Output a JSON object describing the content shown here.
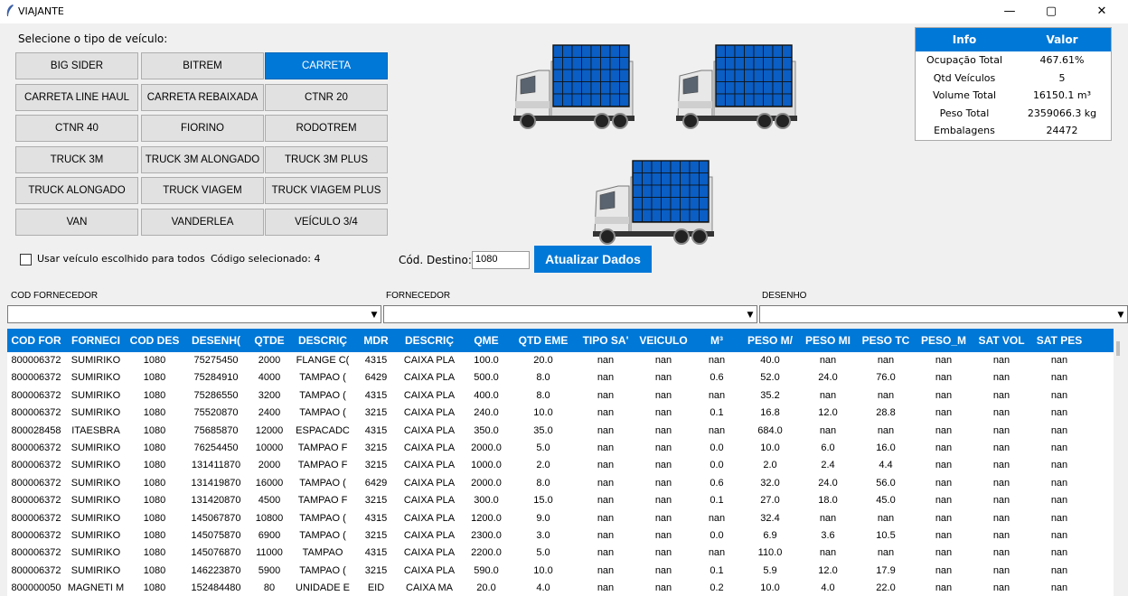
{
  "window": {
    "title": "VIAJANTE",
    "minimize": "—",
    "maximize": "▢",
    "close": "✕"
  },
  "vehicle_type_label": "Selecione o tipo de veículo:",
  "vehicle_buttons": [
    "BIG SIDER",
    "BITREM",
    "CARRETA",
    "CARRETA LINE HAUL",
    "CARRETA REBAIXADA",
    "CTNR 20",
    "CTNR 40",
    "FIORINO",
    "RODOTREM",
    "TRUCK 3M",
    "TRUCK 3M ALONGADO",
    "TRUCK 3M PLUS",
    "TRUCK ALONGADO",
    "TRUCK VIAGEM",
    "TRUCK VIAGEM PLUS",
    "VAN",
    "VANDERLEA",
    "VEÍCULO 3/4"
  ],
  "selected_vehicle": "CARRETA",
  "use_for_all_label": "Usar veículo escolhido para todos",
  "selected_code": "Código selecionado: 4",
  "destination_label": "Cód. Destino:",
  "destination_value": "1080",
  "update_button": "Atualizar Dados",
  "colors": {
    "accent": "#0078d7",
    "cargo": "#0a5ec4",
    "cab": "#e8e8e8"
  },
  "info": {
    "headers": [
      "Info",
      "Valor"
    ],
    "rows": [
      [
        "Ocupação Total",
        "467.61%"
      ],
      [
        "Qtd Veículos",
        "5"
      ],
      [
        "Volume Total",
        "16150.1 m³"
      ],
      [
        "Peso Total",
        "2359066.3 kg"
      ],
      [
        "Embalagens",
        "24472"
      ]
    ]
  },
  "filters": [
    "COD FORNECEDOR",
    "FORNECEDOR",
    "DESENHO"
  ],
  "table": {
    "headers": [
      "COD FOR",
      "FORNECI",
      "COD DES",
      "DESENH(",
      "QTDE",
      "DESCRIÇ",
      "MDR",
      "DESCRIÇ",
      "QME",
      "QTD EME",
      "TIPO SA'",
      "VEICULO",
      "M³",
      "PESO M/",
      "PESO MI",
      "PESO TC",
      "PESO_M",
      "SAT VOL",
      "SAT PES"
    ],
    "rows": [
      [
        "800006372",
        "SUMIRIKO",
        "1080",
        "75275450",
        "2000",
        "FLANGE C(",
        "4315",
        "CAIXA PLA",
        "100.0",
        "20.0",
        "nan",
        "nan",
        "nan",
        "40.0",
        "nan",
        "nan",
        "nan",
        "nan",
        "nan"
      ],
      [
        "800006372",
        "SUMIRIKO",
        "1080",
        "75284910",
        "4000",
        "TAMPAO (",
        "6429",
        "CAIXA PLA",
        "500.0",
        "8.0",
        "nan",
        "nan",
        "0.6",
        "52.0",
        "24.0",
        "76.0",
        "nan",
        "nan",
        "nan"
      ],
      [
        "800006372",
        "SUMIRIKO",
        "1080",
        "75286550",
        "3200",
        "TAMPAO (",
        "4315",
        "CAIXA PLA",
        "400.0",
        "8.0",
        "nan",
        "nan",
        "nan",
        "35.2",
        "nan",
        "nan",
        "nan",
        "nan",
        "nan"
      ],
      [
        "800006372",
        "SUMIRIKO",
        "1080",
        "75520870",
        "2400",
        "TAMPAO (",
        "3215",
        "CAIXA PLA",
        "240.0",
        "10.0",
        "nan",
        "nan",
        "0.1",
        "16.8",
        "12.0",
        "28.8",
        "nan",
        "nan",
        "nan"
      ],
      [
        "800028458",
        "ITAESBRA",
        "1080",
        "75685870",
        "12000",
        "ESPACADC",
        "4315",
        "CAIXA PLA",
        "350.0",
        "35.0",
        "nan",
        "nan",
        "nan",
        "684.0",
        "nan",
        "nan",
        "nan",
        "nan",
        "nan"
      ],
      [
        "800006372",
        "SUMIRIKO",
        "1080",
        "76254450",
        "10000",
        "TAMPAO F",
        "3215",
        "CAIXA PLA",
        "2000.0",
        "5.0",
        "nan",
        "nan",
        "0.0",
        "10.0",
        "6.0",
        "16.0",
        "nan",
        "nan",
        "nan"
      ],
      [
        "800006372",
        "SUMIRIKO",
        "1080",
        "131411870",
        "2000",
        "TAMPAO F",
        "3215",
        "CAIXA PLA",
        "1000.0",
        "2.0",
        "nan",
        "nan",
        "0.0",
        "2.0",
        "2.4",
        "4.4",
        "nan",
        "nan",
        "nan"
      ],
      [
        "800006372",
        "SUMIRIKO",
        "1080",
        "131419870",
        "16000",
        "TAMPAO (",
        "6429",
        "CAIXA PLA",
        "2000.0",
        "8.0",
        "nan",
        "nan",
        "0.6",
        "32.0",
        "24.0",
        "56.0",
        "nan",
        "nan",
        "nan"
      ],
      [
        "800006372",
        "SUMIRIKO",
        "1080",
        "131420870",
        "4500",
        "TAMPAO F",
        "3215",
        "CAIXA PLA",
        "300.0",
        "15.0",
        "nan",
        "nan",
        "0.1",
        "27.0",
        "18.0",
        "45.0",
        "nan",
        "nan",
        "nan"
      ],
      [
        "800006372",
        "SUMIRIKO",
        "1080",
        "145067870",
        "10800",
        "TAMPAO (",
        "4315",
        "CAIXA PLA",
        "1200.0",
        "9.0",
        "nan",
        "nan",
        "nan",
        "32.4",
        "nan",
        "nan",
        "nan",
        "nan",
        "nan"
      ],
      [
        "800006372",
        "SUMIRIKO",
        "1080",
        "145075870",
        "6900",
        "TAMPAO (",
        "3215",
        "CAIXA PLA",
        "2300.0",
        "3.0",
        "nan",
        "nan",
        "0.0",
        "6.9",
        "3.6",
        "10.5",
        "nan",
        "nan",
        "nan"
      ],
      [
        "800006372",
        "SUMIRIKO",
        "1080",
        "145076870",
        "11000",
        "TAMPAO",
        "4315",
        "CAIXA PLA",
        "2200.0",
        "5.0",
        "nan",
        "nan",
        "nan",
        "110.0",
        "nan",
        "nan",
        "nan",
        "nan",
        "nan"
      ],
      [
        "800006372",
        "SUMIRIKO",
        "1080",
        "146223870",
        "5900",
        "TAMPAO (",
        "3215",
        "CAIXA PLA",
        "590.0",
        "10.0",
        "nan",
        "nan",
        "0.1",
        "5.9",
        "12.0",
        "17.9",
        "nan",
        "nan",
        "nan"
      ],
      [
        "800000050",
        "MAGNETI M",
        "1080",
        "152484480",
        "80",
        "UNIDADE E",
        "EID",
        "CAIXA MA",
        "20.0",
        "4.0",
        "nan",
        "nan",
        "0.2",
        "10.0",
        "4.0",
        "22.0",
        "nan",
        "nan",
        "nan"
      ]
    ]
  }
}
